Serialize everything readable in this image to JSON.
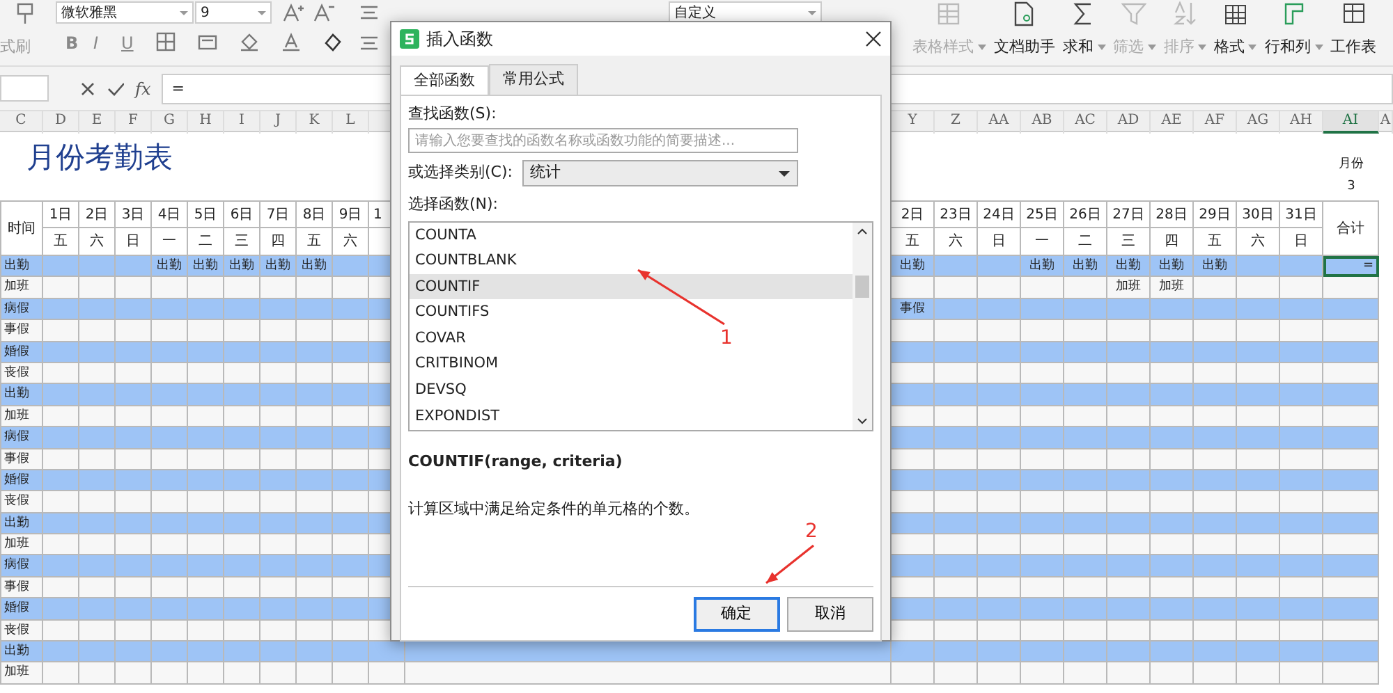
{
  "ribbon": {
    "painter_label": "式刷",
    "font_name": "微软雅黑",
    "font_size": "9",
    "style_buttons": [
      "B",
      "I",
      "U"
    ],
    "number_format": "自定义",
    "tools": [
      {
        "label": "表格样式",
        "kind": "table-style",
        "disabled": true,
        "caret": true
      },
      {
        "label": "文档助手",
        "kind": "doc",
        "disabled": false,
        "caret": false
      },
      {
        "label": "求和",
        "kind": "sum",
        "disabled": false,
        "caret": true
      },
      {
        "label": "筛选",
        "kind": "filter",
        "disabled": true,
        "caret": true
      },
      {
        "label": "排序",
        "kind": "sort",
        "disabled": true,
        "caret": true
      },
      {
        "label": "格式",
        "kind": "format",
        "disabled": false,
        "caret": true
      },
      {
        "label": "行和列",
        "kind": "rowcol",
        "disabled": false,
        "caret": true
      },
      {
        "label": "工作表",
        "kind": "sheet",
        "disabled": false,
        "caret": false
      }
    ]
  },
  "formula_bar": {
    "fx": "fx",
    "value": "="
  },
  "sheet": {
    "title": "月份考勤表",
    "month_label": "月份",
    "month_value": "3",
    "label_column": {
      "letter": "C",
      "header": "时间"
    },
    "left_columns": [
      {
        "letter": "D",
        "day": "1日",
        "weekday": "五"
      },
      {
        "letter": "E",
        "day": "2日",
        "weekday": "六"
      },
      {
        "letter": "F",
        "day": "3日",
        "weekday": "日"
      },
      {
        "letter": "G",
        "day": "4日",
        "weekday": "一"
      },
      {
        "letter": "H",
        "day": "5日",
        "weekday": "二"
      },
      {
        "letter": "I",
        "day": "6日",
        "weekday": "三"
      },
      {
        "letter": "J",
        "day": "7日",
        "weekday": "四"
      },
      {
        "letter": "K",
        "day": "8日",
        "weekday": "五"
      },
      {
        "letter": "L",
        "day": "9日",
        "weekday": "六"
      },
      {
        "day": "1"
      }
    ],
    "right_columns": [
      {
        "letter": "Y",
        "day": "2日",
        "weekday": "五"
      },
      {
        "letter": "Z",
        "day": "23日",
        "weekday": "六"
      },
      {
        "letter": "AA",
        "day": "24日",
        "weekday": "日"
      },
      {
        "letter": "AB",
        "day": "25日",
        "weekday": "一"
      },
      {
        "letter": "AC",
        "day": "26日",
        "weekday": "二"
      },
      {
        "letter": "AD",
        "day": "27日",
        "weekday": "三"
      },
      {
        "letter": "AE",
        "day": "28日",
        "weekday": "四"
      },
      {
        "letter": "AF",
        "day": "29日",
        "weekday": "五"
      },
      {
        "letter": "AG",
        "day": "30日",
        "weekday": "六"
      },
      {
        "letter": "AH",
        "day": "31日",
        "weekday": "日"
      }
    ],
    "total_column": {
      "letter": "AI",
      "header": "合计",
      "selected": true
    },
    "extra_letter": "A",
    "rows": [
      {
        "label": "出勤",
        "shaded": true,
        "cells": {
          "G": "出勤",
          "H": "出勤",
          "I": "出勤",
          "J": "出勤",
          "K": "出勤",
          "Y": "出勤",
          "AB": "出勤",
          "AC": "出勤",
          "AD": "出勤",
          "AE": "出勤",
          "AF": "出勤"
        },
        "total_cell": {
          "text": "=",
          "selected": true
        }
      },
      {
        "label": "加班",
        "shaded": false,
        "cells": {
          "AD": "加班",
          "AE": "加班"
        }
      },
      {
        "label": "病假",
        "shaded": true,
        "cells": {
          "Y": "事假"
        }
      },
      {
        "label": "事假",
        "shaded": false
      },
      {
        "label": "婚假",
        "shaded": true
      },
      {
        "label": "丧假",
        "shaded": false
      },
      {
        "label": "出勤",
        "shaded": true
      },
      {
        "label": "加班",
        "shaded": false
      },
      {
        "label": "病假",
        "shaded": true
      },
      {
        "label": "事假",
        "shaded": false
      },
      {
        "label": "婚假",
        "shaded": true
      },
      {
        "label": "丧假",
        "shaded": false
      },
      {
        "label": "出勤",
        "shaded": true
      },
      {
        "label": "加班",
        "shaded": false
      },
      {
        "label": "病假",
        "shaded": true
      },
      {
        "label": "事假",
        "shaded": false
      },
      {
        "label": "婚假",
        "shaded": true
      },
      {
        "label": "丧假",
        "shaded": false
      },
      {
        "label": "出勤",
        "shaded": true
      },
      {
        "label": "加班",
        "shaded": false
      }
    ]
  },
  "dialog": {
    "title": "插入函数",
    "tabs": [
      {
        "label": "全部函数",
        "selected": true
      },
      {
        "label": "常用公式",
        "selected": false
      }
    ],
    "search_label": "查找函数(S):",
    "search": {
      "placeholder": "请输入您要查找的函数名称或函数功能的简要描述..."
    },
    "category_label": "或选择类别(C):",
    "category": "统计",
    "list_label": "选择函数(N):",
    "functions": [
      {
        "name": "COUNTA",
        "selected": false
      },
      {
        "name": "COUNTBLANK",
        "selected": false
      },
      {
        "name": "COUNTIF",
        "selected": true
      },
      {
        "name": "COUNTIFS",
        "selected": false
      },
      {
        "name": "COVAR",
        "selected": false
      },
      {
        "name": "CRITBINOM",
        "selected": false
      },
      {
        "name": "DEVSQ",
        "selected": false
      },
      {
        "name": "EXPONDIST",
        "selected": false
      }
    ],
    "signature": "COUNTIF(range, criteria)",
    "description": "计算区域中满足给定条件的单元格的个数。",
    "buttons": [
      {
        "label": "确定",
        "default": true
      },
      {
        "label": "取消",
        "default": false
      }
    ]
  },
  "annotations": [
    {
      "text": "1"
    },
    {
      "text": "2"
    }
  ]
}
